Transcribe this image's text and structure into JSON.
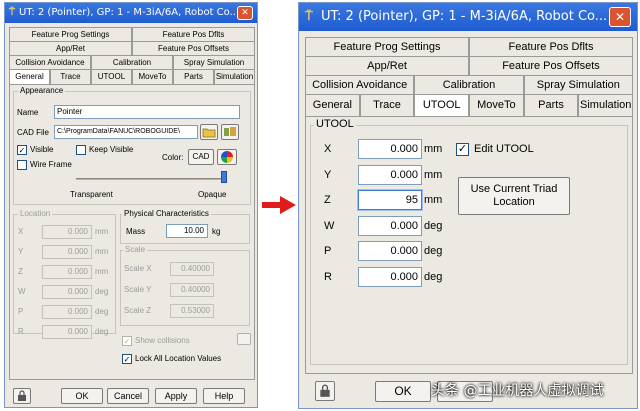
{
  "left_window": {
    "title": "UT: 2  (Pointer), GP: 1 - M-3iA/6A, Robot Co...",
    "close": "✕",
    "tabs_row1": [
      "Feature Prog Settings",
      "Feature Pos Dflts"
    ],
    "tabs_row2": [
      "App/Ret",
      "Feature Pos Offsets"
    ],
    "tabs_row3": [
      "Collision Avoidance",
      "Calibration",
      "Spray Simulation"
    ],
    "tabs_row4": [
      "General",
      "Trace",
      "UTOOL",
      "MoveTo",
      "Parts",
      "Simulation"
    ],
    "appearance": {
      "group_label": "Appearance",
      "name_label": "Name",
      "name_value": "Pointer",
      "cad_label": "CAD File",
      "cad_value": "C:\\ProgramData\\FANUC\\ROBOGUIDE\\",
      "visible_label": "Visible",
      "keep_visible_label": "Keep Visible",
      "wireframe_label": "Wire Frame",
      "color_label": "Color",
      "cad_button": "CAD",
      "transparent_label": "Transparent",
      "opaque_label": "Opaque",
      "opacity_level": 1.0
    },
    "location": {
      "group_label": "Location",
      "rows": [
        {
          "axis": "X",
          "value": "0.000",
          "unit": "mm"
        },
        {
          "axis": "Y",
          "value": "0.000",
          "unit": "mm"
        },
        {
          "axis": "Z",
          "value": "0.000",
          "unit": "mm"
        },
        {
          "axis": "W",
          "value": "0.000",
          "unit": "deg"
        },
        {
          "axis": "P",
          "value": "0.000",
          "unit": "deg"
        },
        {
          "axis": "R",
          "value": "0.000",
          "unit": "deg"
        }
      ]
    },
    "physical": {
      "group_label": "Physical Characteristics",
      "mass_label": "Mass",
      "mass_value": "10.00",
      "mass_unit": "kg"
    },
    "scale": {
      "group_label": "Scale",
      "rows": [
        {
          "label": "Scale X",
          "value": "0.40000"
        },
        {
          "label": "Scale Y",
          "value": "0.40000"
        },
        {
          "label": "Scale Z",
          "value": "0.53000"
        }
      ]
    },
    "show_collisions": "Show collisions",
    "lock_all": "Lock All Location Values",
    "buttons": {
      "ok": "OK",
      "cancel": "Cancel",
      "apply": "Apply",
      "help": "Help"
    }
  },
  "right_window": {
    "title": "UT: 2  (Pointer), GP: 1 - M-3iA/6A, Robot Co...",
    "close": "✕",
    "tabs_row1": [
      "Feature Prog Settings",
      "Feature Pos Dflts"
    ],
    "tabs_row2": [
      "App/Ret",
      "Feature Pos Offsets"
    ],
    "tabs_row3": [
      "Collision Avoidance",
      "Calibration",
      "Spray Simulation"
    ],
    "tabs_row4": [
      "General",
      "Trace",
      "UTOOL",
      "MoveTo",
      "Parts",
      "Simulation"
    ],
    "utool": {
      "group_label": "UTOOL",
      "rows": [
        {
          "axis": "X",
          "value": "0.000",
          "unit": "mm"
        },
        {
          "axis": "Y",
          "value": "0.000",
          "unit": "mm"
        },
        {
          "axis": "Z",
          "value": "95",
          "unit": "mm"
        },
        {
          "axis": "W",
          "value": "0.000",
          "unit": "deg"
        },
        {
          "axis": "P",
          "value": "0.000",
          "unit": "deg"
        },
        {
          "axis": "R",
          "value": "0.000",
          "unit": "deg"
        }
      ],
      "edit_utool_label": "Edit UTOOL",
      "use_triad_button": "Use Current Triad Location"
    },
    "buttons": {
      "ok": "OK"
    }
  },
  "watermark": "头条 @工业机器人虚拟调试",
  "colors": {
    "arrow": "#e01b1b",
    "title_bar": "#2563d8",
    "focus": "#3a7bd5"
  }
}
